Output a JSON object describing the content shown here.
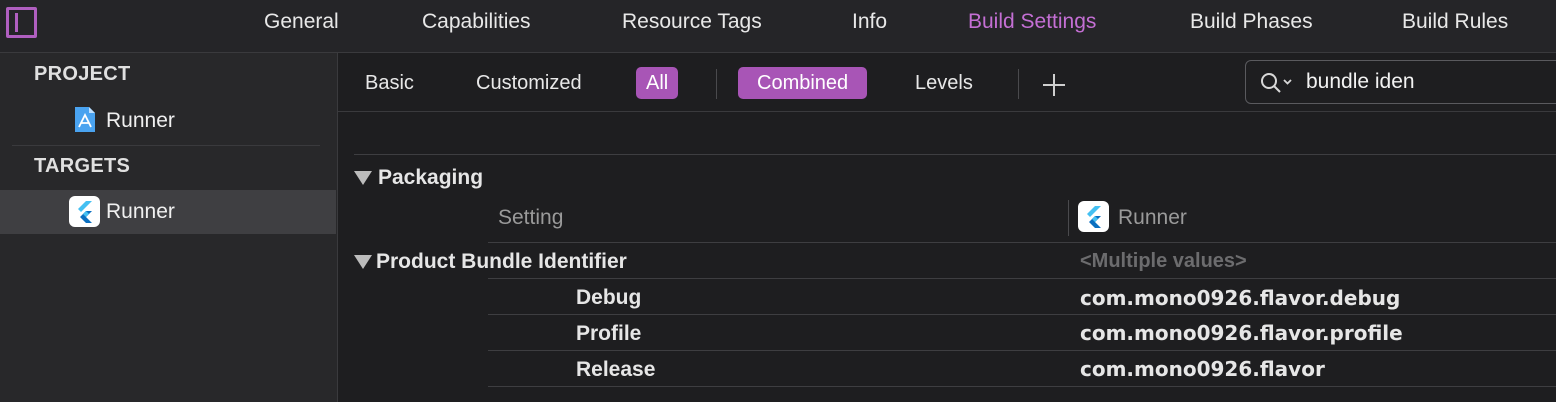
{
  "tabs": [
    {
      "label": "General"
    },
    {
      "label": "Capabilities"
    },
    {
      "label": "Resource Tags"
    },
    {
      "label": "Info"
    },
    {
      "label": "Build Settings"
    },
    {
      "label": "Build Phases"
    },
    {
      "label": "Build Rules"
    }
  ],
  "active_tab": "Build Settings",
  "accent_color": "#a855b6",
  "sidebar": {
    "project_header": "PROJECT",
    "project_item": "Runner",
    "targets_header": "TARGETS",
    "target_item": "Runner"
  },
  "filters": {
    "basic": "Basic",
    "customized": "Customized",
    "all": "All",
    "combined": "Combined",
    "levels": "Levels",
    "add_icon": "plus-icon"
  },
  "search": {
    "value": "bundle iden",
    "icon": "search-icon"
  },
  "settings": {
    "section": "Packaging",
    "column_setting": "Setting",
    "column_target": "Runner",
    "setting_name": "Product Bundle Identifier",
    "setting_value": "<Multiple values>",
    "configs": [
      {
        "name": "Debug",
        "value": "com.mono0926.flavor.debug"
      },
      {
        "name": "Profile",
        "value": "com.mono0926.flavor.profile"
      },
      {
        "name": "Release",
        "value": "com.mono0926.flavor"
      }
    ]
  }
}
